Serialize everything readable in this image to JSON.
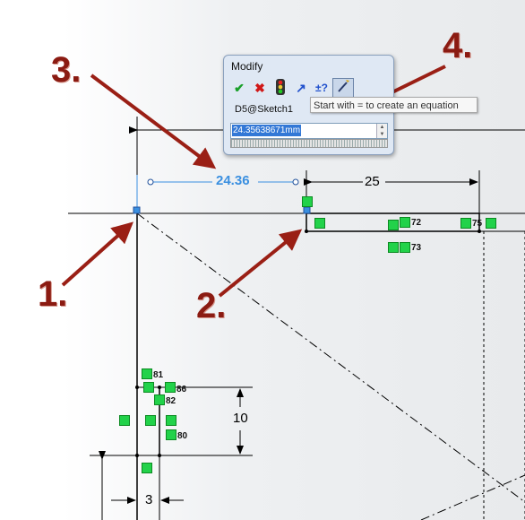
{
  "modify_dialog": {
    "title": "Modify",
    "toolbar": {
      "ok_icon": "checkmark-icon",
      "cancel_icon": "x-icon",
      "rebuild_icon": "traffic-light-icon",
      "reverse_icon": "reverse-direction-icon",
      "marks_label": "±?",
      "wand_icon": "wand-icon"
    },
    "reference": "D5@Sketch1",
    "value": "24.35638671mm",
    "tooltip": "Start with = to create an equation"
  },
  "dimensions": {
    "width_selected": "24.36",
    "width_right": "25",
    "height": "10",
    "small_width": "3"
  },
  "relations": {
    "r72": "72",
    "r73": "73",
    "r75": "75",
    "r80": "80",
    "r81": "81",
    "r82": "82",
    "r86": "86"
  },
  "callouts": {
    "c1": "1.",
    "c2": "2.",
    "c3": "3.",
    "c4": "4."
  },
  "colors": {
    "callout": "#8b1b12",
    "selected_dim": "#3a8fe0",
    "relation_green": "#22d24a",
    "selection_highlight": "#3378d6"
  }
}
